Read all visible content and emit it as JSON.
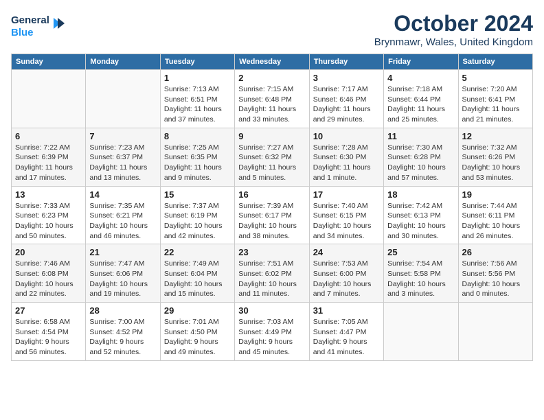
{
  "header": {
    "logo_line1": "General",
    "logo_line2": "Blue",
    "title": "October 2024",
    "subtitle": "Brynmawr, Wales, United Kingdom"
  },
  "weekdays": [
    "Sunday",
    "Monday",
    "Tuesday",
    "Wednesday",
    "Thursday",
    "Friday",
    "Saturday"
  ],
  "weeks": [
    [
      {
        "day": "",
        "detail": ""
      },
      {
        "day": "",
        "detail": ""
      },
      {
        "day": "1",
        "detail": "Sunrise: 7:13 AM\nSunset: 6:51 PM\nDaylight: 11 hours and 37 minutes."
      },
      {
        "day": "2",
        "detail": "Sunrise: 7:15 AM\nSunset: 6:48 PM\nDaylight: 11 hours and 33 minutes."
      },
      {
        "day": "3",
        "detail": "Sunrise: 7:17 AM\nSunset: 6:46 PM\nDaylight: 11 hours and 29 minutes."
      },
      {
        "day": "4",
        "detail": "Sunrise: 7:18 AM\nSunset: 6:44 PM\nDaylight: 11 hours and 25 minutes."
      },
      {
        "day": "5",
        "detail": "Sunrise: 7:20 AM\nSunset: 6:41 PM\nDaylight: 11 hours and 21 minutes."
      }
    ],
    [
      {
        "day": "6",
        "detail": "Sunrise: 7:22 AM\nSunset: 6:39 PM\nDaylight: 11 hours and 17 minutes."
      },
      {
        "day": "7",
        "detail": "Sunrise: 7:23 AM\nSunset: 6:37 PM\nDaylight: 11 hours and 13 minutes."
      },
      {
        "day": "8",
        "detail": "Sunrise: 7:25 AM\nSunset: 6:35 PM\nDaylight: 11 hours and 9 minutes."
      },
      {
        "day": "9",
        "detail": "Sunrise: 7:27 AM\nSunset: 6:32 PM\nDaylight: 11 hours and 5 minutes."
      },
      {
        "day": "10",
        "detail": "Sunrise: 7:28 AM\nSunset: 6:30 PM\nDaylight: 11 hours and 1 minute."
      },
      {
        "day": "11",
        "detail": "Sunrise: 7:30 AM\nSunset: 6:28 PM\nDaylight: 10 hours and 57 minutes."
      },
      {
        "day": "12",
        "detail": "Sunrise: 7:32 AM\nSunset: 6:26 PM\nDaylight: 10 hours and 53 minutes."
      }
    ],
    [
      {
        "day": "13",
        "detail": "Sunrise: 7:33 AM\nSunset: 6:23 PM\nDaylight: 10 hours and 50 minutes."
      },
      {
        "day": "14",
        "detail": "Sunrise: 7:35 AM\nSunset: 6:21 PM\nDaylight: 10 hours and 46 minutes."
      },
      {
        "day": "15",
        "detail": "Sunrise: 7:37 AM\nSunset: 6:19 PM\nDaylight: 10 hours and 42 minutes."
      },
      {
        "day": "16",
        "detail": "Sunrise: 7:39 AM\nSunset: 6:17 PM\nDaylight: 10 hours and 38 minutes."
      },
      {
        "day": "17",
        "detail": "Sunrise: 7:40 AM\nSunset: 6:15 PM\nDaylight: 10 hours and 34 minutes."
      },
      {
        "day": "18",
        "detail": "Sunrise: 7:42 AM\nSunset: 6:13 PM\nDaylight: 10 hours and 30 minutes."
      },
      {
        "day": "19",
        "detail": "Sunrise: 7:44 AM\nSunset: 6:11 PM\nDaylight: 10 hours and 26 minutes."
      }
    ],
    [
      {
        "day": "20",
        "detail": "Sunrise: 7:46 AM\nSunset: 6:08 PM\nDaylight: 10 hours and 22 minutes."
      },
      {
        "day": "21",
        "detail": "Sunrise: 7:47 AM\nSunset: 6:06 PM\nDaylight: 10 hours and 19 minutes."
      },
      {
        "day": "22",
        "detail": "Sunrise: 7:49 AM\nSunset: 6:04 PM\nDaylight: 10 hours and 15 minutes."
      },
      {
        "day": "23",
        "detail": "Sunrise: 7:51 AM\nSunset: 6:02 PM\nDaylight: 10 hours and 11 minutes."
      },
      {
        "day": "24",
        "detail": "Sunrise: 7:53 AM\nSunset: 6:00 PM\nDaylight: 10 hours and 7 minutes."
      },
      {
        "day": "25",
        "detail": "Sunrise: 7:54 AM\nSunset: 5:58 PM\nDaylight: 10 hours and 3 minutes."
      },
      {
        "day": "26",
        "detail": "Sunrise: 7:56 AM\nSunset: 5:56 PM\nDaylight: 10 hours and 0 minutes."
      }
    ],
    [
      {
        "day": "27",
        "detail": "Sunrise: 6:58 AM\nSunset: 4:54 PM\nDaylight: 9 hours and 56 minutes."
      },
      {
        "day": "28",
        "detail": "Sunrise: 7:00 AM\nSunset: 4:52 PM\nDaylight: 9 hours and 52 minutes."
      },
      {
        "day": "29",
        "detail": "Sunrise: 7:01 AM\nSunset: 4:50 PM\nDaylight: 9 hours and 49 minutes."
      },
      {
        "day": "30",
        "detail": "Sunrise: 7:03 AM\nSunset: 4:49 PM\nDaylight: 9 hours and 45 minutes."
      },
      {
        "day": "31",
        "detail": "Sunrise: 7:05 AM\nSunset: 4:47 PM\nDaylight: 9 hours and 41 minutes."
      },
      {
        "day": "",
        "detail": ""
      },
      {
        "day": "",
        "detail": ""
      }
    ]
  ]
}
